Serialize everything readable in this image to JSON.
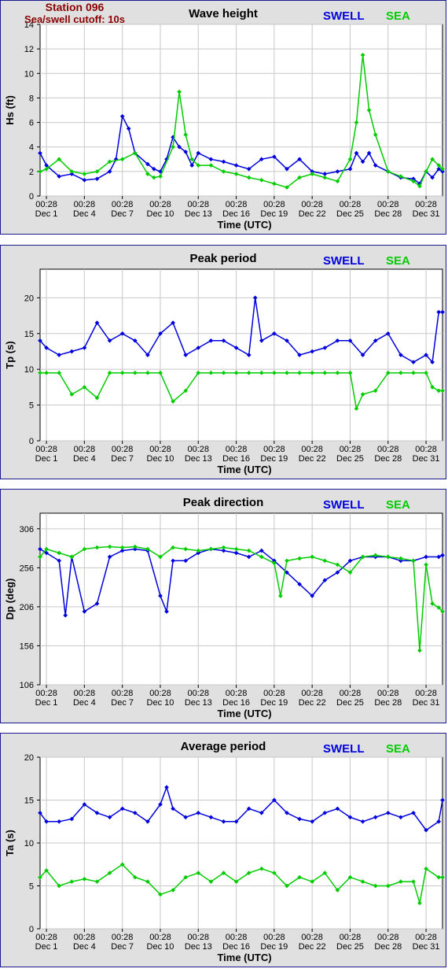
{
  "station": {
    "name": "Station 096",
    "cutoff": "Sea/swell cutoff: 10s"
  },
  "legend": {
    "swell": "SWELL",
    "sea": "SEA"
  },
  "colors": {
    "swell": "#0000dd",
    "sea": "#00cc00",
    "station": "#8b0000",
    "panel_bg": "#e0e0e0",
    "border": "#1a1a8c"
  },
  "x_axis": {
    "label": "Time (UTC)",
    "times": [
      "00:28",
      "00:28",
      "00:28",
      "00:28",
      "00:28",
      "00:28",
      "00:28",
      "00:28",
      "00:28",
      "00:28",
      "00:28"
    ],
    "dates": [
      "Dec 1",
      "Dec 4",
      "Dec 7",
      "Dec 10",
      "Dec 13",
      "Dec 16",
      "Dec 19",
      "Dec 22",
      "Dec 25",
      "Dec 28",
      "Dec 31"
    ],
    "day_positions": [
      1,
      4,
      7,
      10,
      13,
      16,
      19,
      22,
      25,
      28,
      31
    ],
    "range_days": [
      0.5,
      32.3
    ]
  },
  "chart_data": [
    {
      "type": "line",
      "title": "Wave height",
      "xlabel": "Time (UTC)",
      "ylabel": "Hs (ft)",
      "ylim": [
        0,
        14
      ],
      "yticks": [
        0,
        2,
        4,
        6,
        8,
        10,
        12,
        14
      ],
      "grid": true,
      "legend_position": "top-right",
      "series": [
        {
          "name": "SWELL",
          "x": [
            0.5,
            1,
            2,
            3,
            4,
            5,
            6,
            6.5,
            7,
            7.5,
            8,
            9,
            9.5,
            10,
            10.5,
            11,
            11.5,
            12,
            12.5,
            13,
            14,
            15,
            16,
            17,
            18,
            19,
            20,
            21,
            22,
            23,
            24,
            25,
            25.5,
            26,
            26.5,
            27,
            28,
            29,
            30,
            30.5,
            31,
            31.5,
            32,
            32.3
          ],
          "y": [
            3.5,
            2.5,
            1.6,
            1.8,
            1.3,
            1.4,
            2.0,
            3.0,
            6.5,
            5.5,
            3.5,
            2.6,
            2.2,
            2.0,
            3.0,
            4.8,
            4.0,
            3.6,
            2.5,
            3.5,
            3.0,
            2.8,
            2.5,
            2.2,
            3.0,
            3.2,
            2.2,
            3.0,
            2.0,
            1.8,
            2.0,
            2.2,
            3.5,
            2.8,
            3.5,
            2.5,
            2.0,
            1.5,
            1.4,
            1.0,
            2.0,
            1.5,
            2.2,
            2.0
          ]
        },
        {
          "name": "SEA",
          "x": [
            0.5,
            1,
            2,
            3,
            4,
            5,
            6,
            7,
            8,
            9,
            9.5,
            10,
            11,
            11.5,
            12,
            12.5,
            13,
            14,
            15,
            16,
            17,
            18,
            19,
            20,
            21,
            22,
            23,
            24,
            25,
            25.5,
            26,
            26.5,
            27,
            28,
            29,
            30,
            30.5,
            31,
            31.5,
            32,
            32.3
          ],
          "y": [
            2.0,
            2.2,
            3.0,
            2.0,
            1.8,
            2.0,
            2.8,
            3.0,
            3.5,
            1.8,
            1.5,
            1.6,
            4.0,
            8.5,
            5.0,
            3.0,
            2.5,
            2.5,
            2.0,
            1.8,
            1.5,
            1.3,
            1.0,
            0.7,
            1.5,
            1.8,
            1.5,
            1.2,
            3.0,
            6.0,
            11.5,
            7.0,
            5.0,
            2.0,
            1.6,
            1.2,
            0.8,
            2.0,
            3.0,
            2.5,
            2.2
          ]
        }
      ]
    },
    {
      "type": "line",
      "title": "Peak period",
      "xlabel": "Time (UTC)",
      "ylabel": "Tp (s)",
      "ylim": [
        0,
        24
      ],
      "yticks": [
        0,
        5,
        10,
        15,
        20
      ],
      "grid": true,
      "legend_position": "top-right",
      "series": [
        {
          "name": "SWELL",
          "x": [
            0.5,
            1,
            2,
            3,
            4,
            5,
            6,
            7,
            8,
            9,
            10,
            11,
            12,
            13,
            14,
            15,
            16,
            17,
            17.5,
            18,
            19,
            20,
            21,
            22,
            23,
            24,
            25,
            26,
            27,
            28,
            29,
            30,
            31,
            31.5,
            32,
            32.3
          ],
          "y": [
            14,
            13,
            12,
            12.5,
            13,
            16.5,
            14,
            15,
            14,
            12,
            15,
            16.5,
            12,
            13,
            14,
            14,
            13,
            12,
            20,
            14,
            15,
            14,
            12,
            12.5,
            13,
            14,
            14,
            12,
            14,
            15,
            12,
            11,
            12,
            11,
            18,
            18
          ]
        },
        {
          "name": "SEA",
          "x": [
            0.5,
            1,
            2,
            3,
            4,
            5,
            6,
            7,
            8,
            9,
            10,
            11,
            12,
            13,
            14,
            15,
            16,
            17,
            18,
            19,
            20,
            21,
            22,
            23,
            24,
            25,
            25.5,
            26,
            27,
            28,
            29,
            30,
            31,
            31.5,
            32,
            32.3
          ],
          "y": [
            9.5,
            9.5,
            9.5,
            6.5,
            7.5,
            6.0,
            9.5,
            9.5,
            9.5,
            9.5,
            9.5,
            5.5,
            7.0,
            9.5,
            9.5,
            9.5,
            9.5,
            9.5,
            9.5,
            9.5,
            9.5,
            9.5,
            9.5,
            9.5,
            9.5,
            9.5,
            4.5,
            6.5,
            7.0,
            9.5,
            9.5,
            9.5,
            9.5,
            7.5,
            7.0,
            7.0
          ]
        }
      ]
    },
    {
      "type": "line",
      "title": "Peak direction",
      "xlabel": "Time (UTC)",
      "ylabel": "Dp (deg)",
      "ylim": [
        106,
        326
      ],
      "yticks": [
        106,
        156,
        206,
        256,
        306
      ],
      "grid": true,
      "legend_position": "top-right",
      "series": [
        {
          "name": "SWELL",
          "x": [
            0.5,
            1,
            2,
            2.5,
            3,
            4,
            5,
            6,
            7,
            8,
            9,
            10,
            10.5,
            11,
            12,
            13,
            14,
            15,
            16,
            17,
            18,
            19,
            20,
            21,
            22,
            23,
            24,
            25,
            26,
            27,
            28,
            29,
            30,
            31,
            32,
            32.3
          ],
          "y": [
            280,
            275,
            265,
            195,
            270,
            200,
            210,
            270,
            278,
            280,
            278,
            220,
            200,
            265,
            265,
            275,
            280,
            278,
            275,
            270,
            278,
            265,
            250,
            235,
            220,
            240,
            250,
            265,
            270,
            270,
            270,
            265,
            265,
            270,
            270,
            272
          ]
        },
        {
          "name": "SEA",
          "x": [
            0.5,
            1,
            2,
            3,
            4,
            5,
            6,
            7,
            8,
            9,
            10,
            11,
            12,
            13,
            14,
            15,
            16,
            17,
            18,
            19,
            19.5,
            20,
            21,
            22,
            23,
            24,
            25,
            26,
            27,
            28,
            29,
            30,
            30.5,
            31,
            31.5,
            32,
            32.3
          ],
          "y": [
            270,
            280,
            275,
            270,
            280,
            282,
            283,
            282,
            283,
            280,
            270,
            282,
            280,
            278,
            280,
            282,
            280,
            278,
            270,
            262,
            220,
            265,
            268,
            270,
            265,
            260,
            250,
            270,
            272,
            270,
            268,
            265,
            150,
            260,
            210,
            205,
            200
          ]
        }
      ]
    },
    {
      "type": "line",
      "title": "Average period",
      "xlabel": "Time (UTC)",
      "ylabel": "Ta (s)",
      "ylim": [
        0,
        20
      ],
      "yticks": [
        0,
        5,
        10,
        15,
        20
      ],
      "grid": true,
      "legend_position": "top-right",
      "series": [
        {
          "name": "SWELL",
          "x": [
            0.5,
            1,
            2,
            3,
            4,
            5,
            6,
            7,
            8,
            9,
            10,
            10.5,
            11,
            12,
            13,
            14,
            15,
            16,
            17,
            18,
            19,
            20,
            21,
            22,
            23,
            24,
            25,
            26,
            27,
            28,
            29,
            30,
            31,
            32,
            32.3
          ],
          "y": [
            13.5,
            12.5,
            12.5,
            12.8,
            14.5,
            13.5,
            13.0,
            14.0,
            13.5,
            12.5,
            14.5,
            16.5,
            14.0,
            13.0,
            13.5,
            13.0,
            12.5,
            12.5,
            14.0,
            13.5,
            15.0,
            13.5,
            12.8,
            12.5,
            13.5,
            14.0,
            13.0,
            12.5,
            13.0,
            13.5,
            13.0,
            13.5,
            11.5,
            12.5,
            15.0
          ]
        },
        {
          "name": "SEA",
          "x": [
            0.5,
            1,
            2,
            3,
            4,
            5,
            6,
            7,
            8,
            9,
            10,
            11,
            12,
            13,
            14,
            15,
            16,
            17,
            18,
            19,
            20,
            21,
            22,
            23,
            24,
            25,
            26,
            27,
            28,
            29,
            30,
            30.5,
            31,
            32,
            32.3
          ],
          "y": [
            6.0,
            6.8,
            5.0,
            5.5,
            5.8,
            5.5,
            6.5,
            7.5,
            6.0,
            5.5,
            4.0,
            4.5,
            6.0,
            6.5,
            5.5,
            6.5,
            5.5,
            6.5,
            7.0,
            6.5,
            5.0,
            6.0,
            5.5,
            6.5,
            4.5,
            6.0,
            5.5,
            5.0,
            5.0,
            5.5,
            5.5,
            3.0,
            7.0,
            6.0,
            6.0
          ]
        }
      ]
    }
  ]
}
